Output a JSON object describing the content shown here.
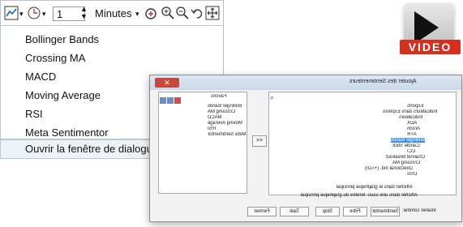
{
  "toolbar": {
    "period_value": "1",
    "unit_label": "Minutes"
  },
  "menu": {
    "items": [
      {
        "label": "Bollinger Bands"
      },
      {
        "label": "Crossing MA"
      },
      {
        "label": "MACD"
      },
      {
        "label": "Moving Average"
      },
      {
        "label": "RSI"
      },
      {
        "label": "Meta Sentimentor"
      }
    ],
    "open_dialog_label": "Ouvrir la fenêtre de dialogue 'Ajout S"
  },
  "video_badge": {
    "label": "VIDEO"
  },
  "dialog": {
    "title": "Ajouter des Sentimenteurs",
    "favorites_header": "Favoris",
    "favorites": [
      "Bollinger Bands",
      "Crossing MA",
      "MACD",
      "Moving Average",
      "RSI",
      "Meta Sentimentor"
    ],
    "tree": [
      "Exports",
      "Indicateurs dans Express",
      "Indicateurs",
      "ADX",
      "Aroon",
      "ATR",
      "Bollinger Bands",
      "Candle Stick",
      "CCI",
      "Channel Breakout",
      "Crossing MA",
      "Directional Ind. (+/-DI)",
      "DSS"
    ],
    "selected_tree_item": "Bollinger Bands",
    "transfer_button": ">>",
    "radio_main": "Afficher dans le graphique principal",
    "radio_sub": "Afficher dans une sous- fenêtre du graphique principal",
    "save_as_label": "Insérer comme:",
    "buttons": [
      "Sentimentor",
      "Filtre",
      "Stop",
      "Task",
      "Fermer"
    ]
  }
}
